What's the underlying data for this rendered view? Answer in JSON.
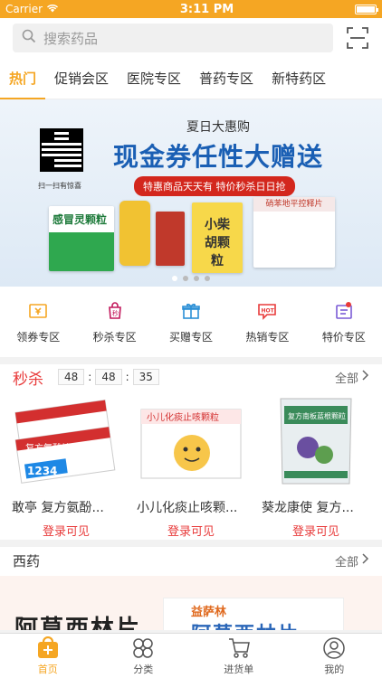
{
  "status_bar": {
    "carrier": "Carrier",
    "time": "3:11 PM"
  },
  "search": {
    "placeholder": "搜索药品"
  },
  "tabs": [
    {
      "label": "热门",
      "active": true
    },
    {
      "label": "促销会区"
    },
    {
      "label": "医院专区"
    },
    {
      "label": "普药专区"
    },
    {
      "label": "新特药区"
    }
  ],
  "banner": {
    "qr_caption": "扫一扫有惊喜",
    "subtitle": "夏日大惠购",
    "title": "现金券任性大赠送",
    "tag": "特惠商品天天有 特价秒杀日日抢",
    "product_labels": [
      "感冒灵颗粒",
      "小柴胡颗粒",
      "硝苯地平控释片"
    ]
  },
  "quick_menu": [
    {
      "label": "领券专区",
      "icon": "coupon-icon"
    },
    {
      "label": "秒杀专区",
      "icon": "flash-sale-icon"
    },
    {
      "label": "买赠专区",
      "icon": "gift-icon"
    },
    {
      "label": "热销专区",
      "icon": "hot-icon"
    },
    {
      "label": "特价专区",
      "icon": "special-price-icon"
    }
  ],
  "seckill": {
    "title": "秒杀",
    "timer": {
      "h": "48",
      "m": "48",
      "s": "35"
    },
    "more": "全部",
    "products": [
      {
        "name": "敢亭 复方氨酚...",
        "price": "登录可见",
        "box_label": "复方氨酚烷胺片",
        "box_sub": "1234"
      },
      {
        "name": "小儿化痰止咳颗...",
        "price": "登录可见",
        "box_label": "小儿化痰止咳颗粒"
      },
      {
        "name": "葵龙康使 复方...",
        "price": "登录可见",
        "box_label": "复方南板蓝根颗粒"
      }
    ]
  },
  "western": {
    "title": "西药",
    "more": "全部",
    "ad_big": "阿莫西林片",
    "ad_brand": "益萨林",
    "ad_big2": "阿莫西林片"
  },
  "tabbar": [
    {
      "label": "首页",
      "active": true,
      "icon": "home-icon"
    },
    {
      "label": "分类",
      "icon": "category-icon"
    },
    {
      "label": "进货单",
      "icon": "cart-icon"
    },
    {
      "label": "我的",
      "icon": "profile-icon"
    }
  ],
  "colors": {
    "accent": "#f5a623",
    "red": "#e83a3a",
    "blue": "#1a5fb4"
  }
}
